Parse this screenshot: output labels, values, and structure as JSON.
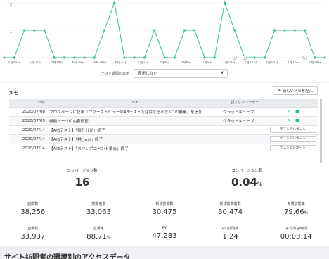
{
  "chart_data": {
    "type": "line",
    "x_tick_labels": [
      "7月20日",
      "6月22日",
      "6月24日",
      "6月26日",
      "6月28日",
      "6月30日",
      "7月2日",
      "7月4日",
      "7月6日",
      "7月8日",
      "7月10日",
      "7月12日",
      "7月14日",
      "7月16日",
      "7月18日"
    ],
    "y_tick_labels": [
      "2",
      "1"
    ],
    "ylim": [
      0,
      2
    ],
    "values": [
      0,
      0,
      1,
      1,
      1,
      0,
      0,
      0,
      0,
      0,
      1,
      2,
      0,
      0,
      0,
      1,
      0,
      0,
      1,
      1,
      0,
      0,
      2,
      1,
      0,
      0,
      0,
      1,
      1,
      1,
      1,
      0,
      0
    ],
    "markers": [
      {
        "index": 23,
        "label": "A"
      },
      {
        "index": 24,
        "label": "A"
      },
      {
        "index": 30,
        "label": "A"
      }
    ],
    "line_color": "#2fbf9b"
  },
  "chart_controls": {
    "test_period_label": "テスト期間の表示",
    "select_value": "表示しない"
  },
  "memo": {
    "title": "メモ",
    "new_button": "新しいメモを記入",
    "headers": {
      "date": "日付",
      "memo": "メモ",
      "user": "記入したユーザー"
    },
    "rows": [
      {
        "date": "2020/07/08",
        "memo": "ブログページに記事「ファーストビューのABテストで注目するべき5つの要素」を追加",
        "user": "グラッドキューブ",
        "kind": "edit"
      },
      {
        "date": "2020/07/09",
        "memo": "機能ページの内容修正",
        "user": "グラッドキューブ",
        "kind": "edit"
      },
      {
        "date": "2020/07/14",
        "memo": "【A/Bテスト】「振り分け」終了",
        "user": "",
        "kind": "report",
        "button": "テストのレポート"
      },
      {
        "date": "2020/07/14",
        "memo": "【A/Bテスト】「林_test」終了",
        "user": "",
        "kind": "report",
        "button": "テストのレポート"
      },
      {
        "date": "2020/07/14",
        "memo": "【A/Bテスト】「スマレポコメント消去」終了",
        "user": "",
        "kind": "report",
        "button": "テストのレポート"
      }
    ]
  },
  "stats": {
    "conversions": {
      "label": "コンバージョン数",
      "value": "16"
    },
    "cv_rate": {
      "label": "コンバージョン率",
      "value": "0.04",
      "unit": "%"
    },
    "row1": [
      {
        "label": "訪問数",
        "value": "38,256",
        "unit": ""
      },
      {
        "label": "訪問者数",
        "value": "33,063",
        "unit": ""
      },
      {
        "label": "新規訪問数",
        "value": "30,475",
        "unit": ""
      },
      {
        "label": "新規訪問者数",
        "value": "30,474",
        "unit": ""
      },
      {
        "label": "新規訪問率",
        "value": "79.66",
        "unit": "%"
      }
    ],
    "row2": [
      {
        "label": "直帰数",
        "value": "33,937",
        "unit": ""
      },
      {
        "label": "直帰率",
        "value": "88.71",
        "unit": "%"
      },
      {
        "label": "PV",
        "value": "47,283",
        "unit": ""
      },
      {
        "label": "PV/訪問数",
        "value": "1.24",
        "unit": ""
      },
      {
        "label": "平均滞在時間",
        "value": "00:03:14",
        "unit": ""
      }
    ]
  },
  "section_title": "サイト訪問者の環境別のアクセスデータ"
}
